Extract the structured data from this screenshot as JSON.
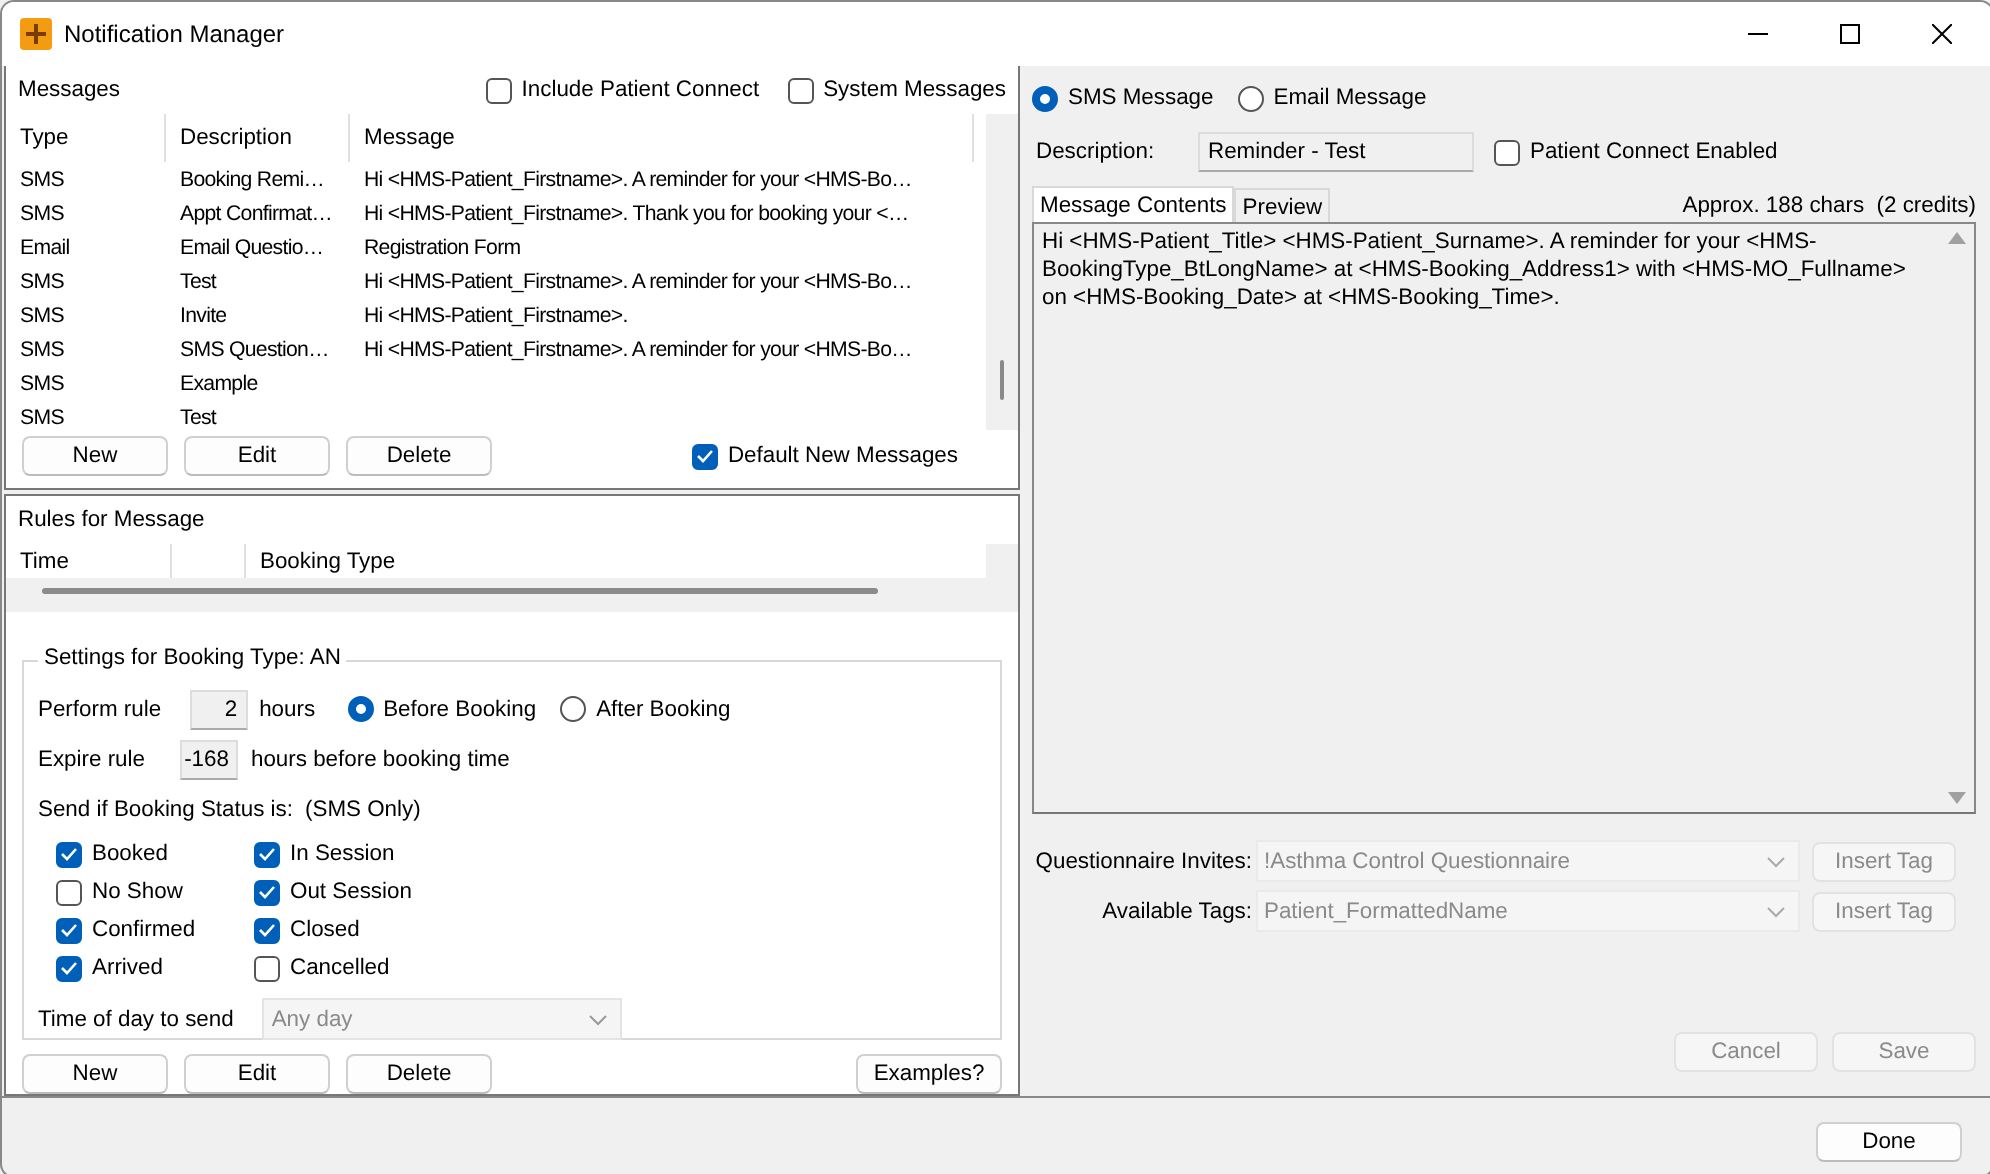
{
  "window": {
    "title": "Notification Manager"
  },
  "messages": {
    "title": "Messages",
    "filters": [
      {
        "label": "Include Patient Connect",
        "checked": false
      },
      {
        "label": "System Messages",
        "checked": false
      }
    ],
    "columns": [
      "Type",
      "Description",
      "Message"
    ],
    "rows": [
      {
        "type": "SMS",
        "description": "Booking Remi…",
        "message": "Hi <HMS-Patient_Firstname>. A reminder for your <HMS-Bo…"
      },
      {
        "type": "SMS",
        "description": "Appt Confirmat…",
        "message": "Hi <HMS-Patient_Firstname>. Thank you for booking your <…"
      },
      {
        "type": "Email",
        "description": "Email Questio…",
        "message": "Registration Form"
      },
      {
        "type": "SMS",
        "description": "Test",
        "message": "Hi <HMS-Patient_Firstname>. A reminder for your <HMS-Bo…"
      },
      {
        "type": "SMS",
        "description": "Invite",
        "message": "Hi <HMS-Patient_Firstname>."
      },
      {
        "type": "SMS",
        "description": "SMS Question…",
        "message": "Hi <HMS-Patient_Firstname>. A reminder for your <HMS-Bo…"
      },
      {
        "type": "SMS",
        "description": "Example"
      },
      {
        "type": "SMS",
        "description": "Test"
      }
    ],
    "buttons": [
      "New",
      "Edit",
      "Delete"
    ],
    "default_new": {
      "label": "Default New Messages",
      "checked": true
    }
  },
  "rules": {
    "title": "Rules for Message",
    "columns": [
      "Time",
      "Booking Type"
    ],
    "settings": {
      "title": "Settings for Booking Type: AN",
      "perform_label": "Perform rule",
      "perform_value": "2",
      "perform_unit": "hours",
      "timing": [
        {
          "label": "Before Booking",
          "selected": true
        },
        {
          "label": "After Booking",
          "selected": false
        }
      ],
      "expire_label": "Expire rule",
      "expire_value": "-168",
      "expire_unit": "hours before booking time",
      "status_label": "Send if Booking Status is:",
      "status_note": "(SMS Only)",
      "statuses": [
        {
          "label": "Booked",
          "checked": true
        },
        {
          "label": "No Show",
          "checked": false
        },
        {
          "label": "Confirmed",
          "checked": true
        },
        {
          "label": "Arrived",
          "checked": true
        },
        {
          "label": "In Session",
          "checked": true
        },
        {
          "label": "Out Session",
          "checked": true
        },
        {
          "label": "Closed",
          "checked": true
        },
        {
          "label": "Cancelled",
          "checked": false
        }
      ],
      "time_label": "Time of day to send",
      "time_value": "Any day"
    },
    "buttons": [
      "New",
      "Edit",
      "Delete"
    ],
    "examples_button": "Examples?"
  },
  "editor": {
    "message_type": [
      {
        "label": "SMS Message",
        "selected": true
      },
      {
        "label": "Email Message",
        "selected": false
      }
    ],
    "description_label": "Description:",
    "description": "Reminder - Test",
    "patient_connect": {
      "label": "Patient Connect Enabled",
      "checked": false
    },
    "tabs": [
      {
        "label": "Message Contents",
        "selected": true
      },
      {
        "label": "Preview",
        "selected": false
      }
    ],
    "char_count": "Approx. 188 chars  (2 credits)",
    "content": "Hi <HMS-Patient_Title> <HMS-Patient_Surname>. A reminder for your <HMS-BookingType_BtLongName> at <HMS-Booking_Address1> with <HMS-MO_Fullname> on <HMS-Booking_Date> at <HMS-Booking_Time>.",
    "pickers": [
      {
        "label": "Questionnaire Invites:",
        "value": "!Asthma Control Questionnaire",
        "button": "Insert Tag"
      },
      {
        "label": "Available Tags:",
        "value": "Patient_FormattedName",
        "button": "Insert Tag"
      }
    ],
    "buttons": [
      {
        "label": "Cancel",
        "disabled": true
      },
      {
        "label": "Save",
        "disabled": true
      }
    ]
  },
  "footer": {
    "done": "Done"
  }
}
